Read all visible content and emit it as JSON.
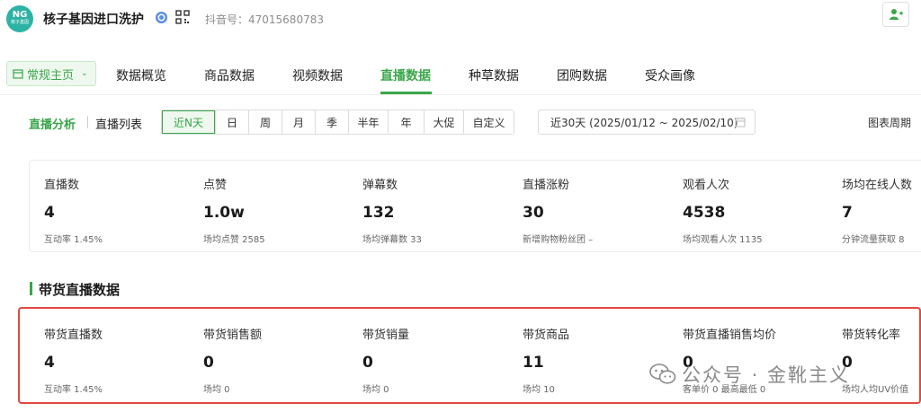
{
  "header": {
    "logo_text": "NG",
    "logo_subtext": "核子基因",
    "brand_name": "核子基因进口洗护",
    "account_id": "抖音号：47015680783"
  },
  "nav": {
    "home_label": "常规主页",
    "tabs": [
      {
        "label": "数据概览"
      },
      {
        "label": "商品数据"
      },
      {
        "label": "视频数据"
      },
      {
        "label": "直播数据"
      },
      {
        "label": "种草数据"
      },
      {
        "label": "团购数据"
      },
      {
        "label": "受众画像"
      }
    ],
    "active_tab": "直播数据"
  },
  "filters": {
    "sub_tabs": [
      {
        "label": "直播分析"
      },
      {
        "label": "直播列表"
      }
    ],
    "periods": [
      {
        "label": "近N天"
      },
      {
        "label": "日"
      },
      {
        "label": "周"
      },
      {
        "label": "月"
      },
      {
        "label": "季"
      },
      {
        "label": "半年"
      },
      {
        "label": "年"
      },
      {
        "label": "大促"
      },
      {
        "label": "自定义"
      }
    ],
    "active_period": "近N天",
    "date_range": "近30天 (2025/01/12 ~ 2025/02/10)",
    "chart_period_label": "图表周期"
  },
  "live_stats": [
    {
      "label": "直播数",
      "value": "4",
      "sub": "互动率 1.45%"
    },
    {
      "label": "点赞",
      "value": "1.0w",
      "sub": "场均点赞 2585"
    },
    {
      "label": "弹幕数",
      "value": "132",
      "sub": "场均弹幕数 33"
    },
    {
      "label": "直播涨粉",
      "value": "30",
      "sub": "新增购物粉丝团 –"
    },
    {
      "label": "观看人次",
      "value": "4538",
      "sub": "场均观看人次 1135"
    },
    {
      "label": "场均在线人数",
      "value": "7",
      "sub": "分钟流量获取 8"
    }
  ],
  "sales_section_title": "带货直播数据",
  "sales_stats": [
    {
      "label": "带货直播数",
      "value": "4",
      "sub": "互动率 1.45%"
    },
    {
      "label": "带货销售额",
      "value": "0",
      "sub": "场均 0"
    },
    {
      "label": "带货销量",
      "value": "0",
      "sub": "场均 0"
    },
    {
      "label": "带货商品",
      "value": "11",
      "sub": "场均 10"
    },
    {
      "label": "带货直播销售均价",
      "value": "0",
      "sub": "客单价 0   最高最低 0"
    },
    {
      "label": "带货转化率",
      "value": "0",
      "sub": "场均人均UV价值"
    }
  ],
  "watermark": "公众号 · 金靴主义",
  "colors": {
    "accent": "#3aa64a",
    "highlight_border": "#e3483f",
    "logo": "#2db3a5"
  }
}
